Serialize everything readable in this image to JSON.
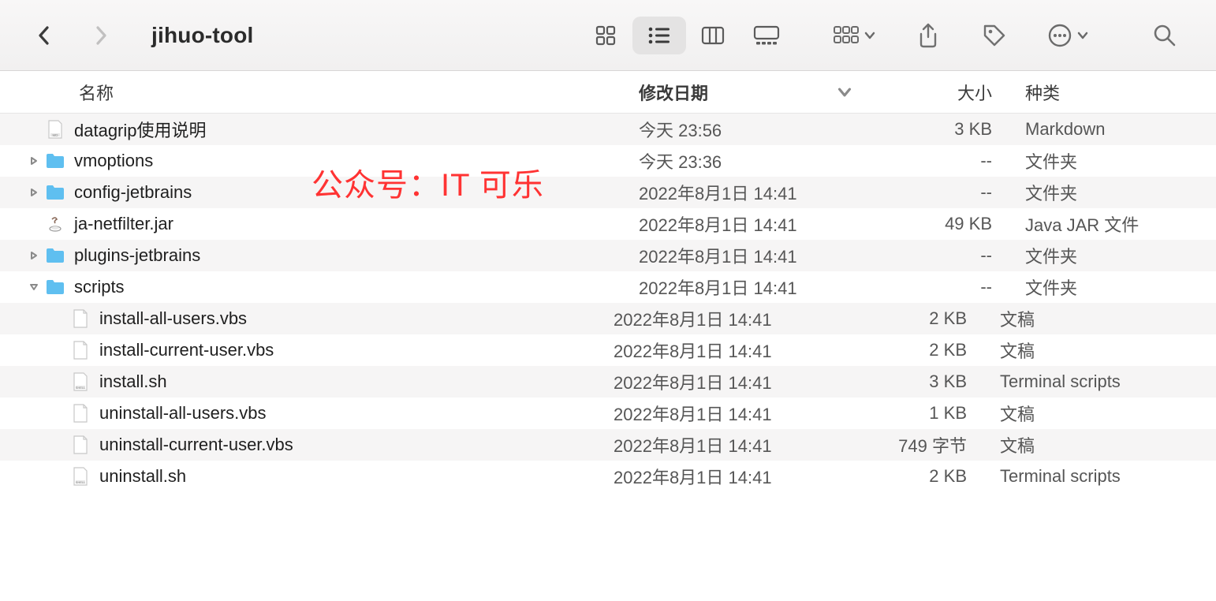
{
  "toolbar": {
    "title": "jihuo-tool"
  },
  "columns": {
    "name": "名称",
    "date": "修改日期",
    "size": "大小",
    "kind": "种类"
  },
  "watermark": "公众号：IT 可乐",
  "rows": [
    {
      "name": "datagrip使用说明",
      "date": "今天 23:56",
      "size": "3 KB",
      "kind": "Markdown",
      "icon": "md",
      "expandable": false,
      "depth": 1
    },
    {
      "name": "vmoptions",
      "date": "今天 23:36",
      "size": "--",
      "kind": "文件夹",
      "icon": "folder",
      "expandable": true,
      "expanded": false,
      "depth": 1
    },
    {
      "name": "config-jetbrains",
      "date": "2022年8月1日 14:41",
      "size": "--",
      "kind": "文件夹",
      "icon": "folder",
      "expandable": true,
      "expanded": false,
      "depth": 1
    },
    {
      "name": "ja-netfilter.jar",
      "date": "2022年8月1日 14:41",
      "size": "49 KB",
      "kind": "Java JAR 文件",
      "icon": "jar",
      "expandable": false,
      "depth": 1
    },
    {
      "name": "plugins-jetbrains",
      "date": "2022年8月1日 14:41",
      "size": "--",
      "kind": "文件夹",
      "icon": "folder",
      "expandable": true,
      "expanded": false,
      "depth": 1
    },
    {
      "name": "scripts",
      "date": "2022年8月1日 14:41",
      "size": "--",
      "kind": "文件夹",
      "icon": "folder",
      "expandable": true,
      "expanded": true,
      "depth": 1
    },
    {
      "name": "install-all-users.vbs",
      "date": "2022年8月1日 14:41",
      "size": "2 KB",
      "kind": "文稿",
      "icon": "doc",
      "expandable": false,
      "depth": 2
    },
    {
      "name": "install-current-user.vbs",
      "date": "2022年8月1日 14:41",
      "size": "2 KB",
      "kind": "文稿",
      "icon": "doc",
      "expandable": false,
      "depth": 2
    },
    {
      "name": "install.sh",
      "date": "2022年8月1日 14:41",
      "size": "3 KB",
      "kind": "Terminal scripts",
      "icon": "shell",
      "expandable": false,
      "depth": 2
    },
    {
      "name": "uninstall-all-users.vbs",
      "date": "2022年8月1日 14:41",
      "size": "1 KB",
      "kind": "文稿",
      "icon": "doc",
      "expandable": false,
      "depth": 2
    },
    {
      "name": "uninstall-current-user.vbs",
      "date": "2022年8月1日 14:41",
      "size": "749 字节",
      "kind": "文稿",
      "icon": "doc",
      "expandable": false,
      "depth": 2
    },
    {
      "name": "uninstall.sh",
      "date": "2022年8月1日 14:41",
      "size": "2 KB",
      "kind": "Terminal scripts",
      "icon": "shell",
      "expandable": false,
      "depth": 2
    }
  ]
}
